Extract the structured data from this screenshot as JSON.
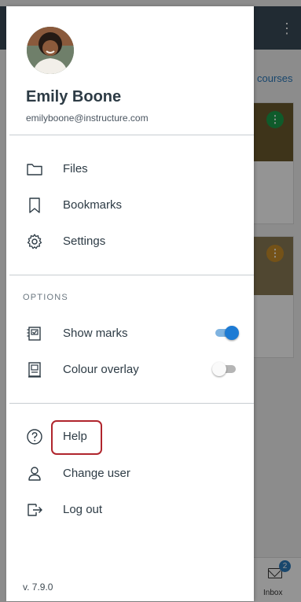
{
  "background": {
    "courses_link": "courses",
    "inbox_label": "Inbox",
    "inbox_badge": "2"
  },
  "profile": {
    "name": "Emily Boone",
    "email": "emilyboone@instructure.com",
    "avatar": "profile-photo"
  },
  "menu": {
    "files": {
      "label": "Files",
      "icon": "folder-icon"
    },
    "bookmarks": {
      "label": "Bookmarks",
      "icon": "bookmark-icon"
    },
    "settings": {
      "label": "Settings",
      "icon": "gear-icon"
    }
  },
  "options": {
    "header": "OPTIONS",
    "show_marks": {
      "label": "Show marks",
      "icon": "marks-icon",
      "enabled": true
    },
    "colour_overlay": {
      "label": "Colour overlay",
      "icon": "overlay-icon",
      "enabled": false
    }
  },
  "account": {
    "help": {
      "label": "Help",
      "icon": "help-icon"
    },
    "change_user": {
      "label": "Change user",
      "icon": "user-icon"
    },
    "log_out": {
      "label": "Log out",
      "icon": "logout-icon"
    }
  },
  "version": "v. 7.9.0",
  "colors": {
    "accent": "#1d7bd4",
    "highlight": "#b0252d",
    "text": "#2d3b45"
  }
}
